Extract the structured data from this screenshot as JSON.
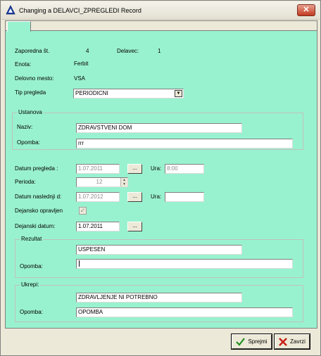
{
  "window": {
    "title": "Changing a DELAVCI_ZPREGLEDI Record",
    "close_glyph": "✕"
  },
  "info": {
    "zaporedna_label": "Zaporedna št.",
    "zaporedna_value": "4",
    "delavec_label": "Delavec:",
    "delavec_value": "1",
    "enota_label": "Enota:",
    "enota_value": "Ferbit",
    "delovno_mesto_label": "Delovno mesto:",
    "delovno_mesto_value": "VSA",
    "tip_pregleda_label": "Tip pregleda",
    "tip_pregleda_value": "PERIODICNI"
  },
  "ustanova": {
    "title": "Ustanova",
    "naziv_label": "Naziv:",
    "naziv_value": "ZDRAVSTVENI DOM",
    "opomba_label": "Opomba:",
    "opomba_value": "rrr"
  },
  "dates": {
    "datum_pregleda_label": "Datum pregleda :",
    "datum_pregleda_value": "1.07.2011",
    "ura_label": "Ura:",
    "ura_value": "8:00",
    "perioda_label": "Perioda:",
    "perioda_value": "12",
    "datum_naslednji_label": "Datum naslednji d:",
    "datum_naslednji_value": "1.07.2012",
    "ura2_label": "Ura:",
    "ura2_value": "",
    "dejansko_label": "Dejansko opravljen",
    "dejansko_checked": true,
    "dejanski_datum_label": "Dejanski datum:",
    "dejanski_datum_value": "1.07.2011",
    "dots_label": "..."
  },
  "rezultat": {
    "title": "Rezultat",
    "value": "USPESEN",
    "opomba_label": "Opomba:",
    "opomba_value": ""
  },
  "ukrepi": {
    "title": "Ukrepi:",
    "value": "ZDRAVLJENJE NI POTREBNO",
    "opomba_label": "Opomba:",
    "opomba_value": "OPOMBA"
  },
  "buttons": {
    "save_label": "Sprejmi",
    "cancel_label": "Zavrzi"
  },
  "icons": {
    "app": "triangle-app-icon",
    "save": "check-icon",
    "cancel": "x-icon"
  },
  "colors": {
    "panel": "#99f2cf",
    "chrome": "#ece9d8",
    "close": "#c23a21"
  }
}
